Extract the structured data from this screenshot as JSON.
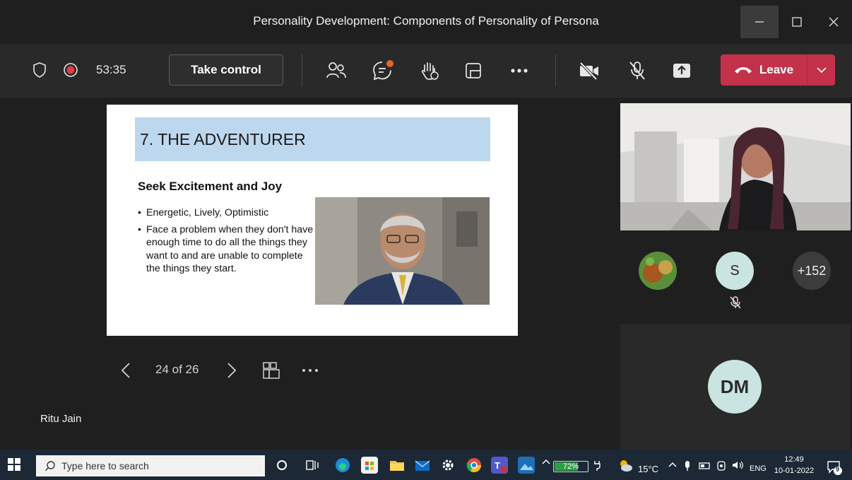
{
  "window": {
    "title": "Personality Development: Components of Personality of Persona"
  },
  "toolbar": {
    "timer": "53:35",
    "take_control_label": "Take control",
    "leave_label": "Leave",
    "chat_badge_color": "#e8652f"
  },
  "slide": {
    "title": "7. THE ADVENTURER",
    "heading": "Seek Excitement and Joy",
    "bullets": [
      "Energetic, Lively, Optimistic",
      "Face a problem when they don't have enough time to do all the things they want to and are unable to complete the things they start."
    ]
  },
  "slide_nav": {
    "page_counter": "24 of 26"
  },
  "presenter": {
    "name": "Ritu Jain"
  },
  "participants": {
    "s_initial": "S",
    "more_count": "+152",
    "dm_initials": "DM"
  },
  "taskbar": {
    "search_placeholder": "Type here to search",
    "battery_label": "72%",
    "battery_level": 0.72,
    "temperature": "15°C",
    "language": "ENG",
    "time": "12:49",
    "date": "10-01-2022",
    "notification_count": "9"
  },
  "colors": {
    "leave": "#c4314b",
    "slide_title_bg": "#bdd7ee",
    "avatar_bg": "#c9e4e1"
  }
}
